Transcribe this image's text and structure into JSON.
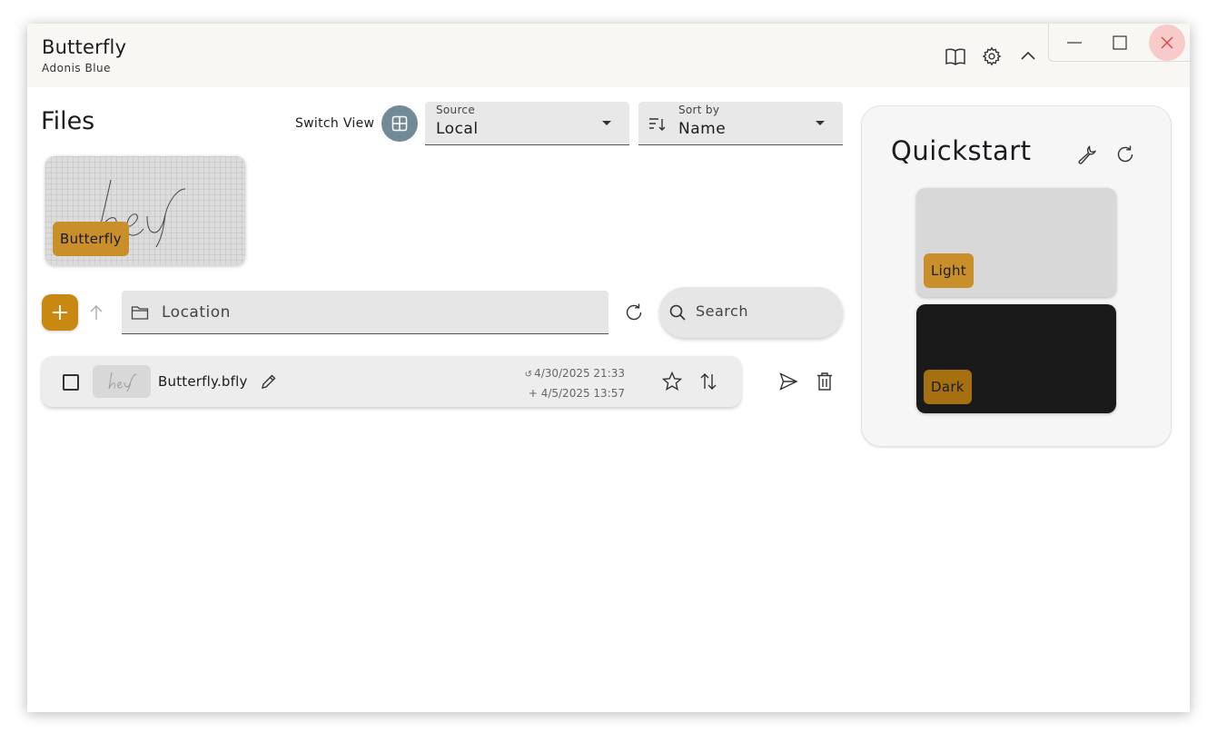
{
  "app": {
    "title": "Butterfly",
    "subtitle": "Adonis Blue"
  },
  "titlebar": {
    "icons": [
      "book-icon",
      "gear-icon",
      "chevron-up-icon"
    ]
  },
  "window_controls": [
    "minimize-icon",
    "maximize-icon",
    "close-icon"
  ],
  "files": {
    "heading": "Files",
    "switch_view_label": "Switch View",
    "source": {
      "label": "Source",
      "value": "Local"
    },
    "sort": {
      "label": "Sort by",
      "value": "Name"
    },
    "recent_card": {
      "name": "Butterfly",
      "preview_text": "hey"
    }
  },
  "toolbar": {
    "location_placeholder": "Location",
    "search_placeholder": "Search"
  },
  "file_list": [
    {
      "name": "Butterfly.bfly",
      "thumb_text": "hey",
      "modified": "4/30/2025 21:33",
      "created": "+ 4/5/2025 13:57"
    }
  ],
  "quickstart": {
    "title": "Quickstart",
    "templates": [
      {
        "label": "Light",
        "background": "#d8d8d8",
        "chip_color": "#c98f2b"
      },
      {
        "label": "Dark",
        "background": "#1a1a1a",
        "chip_color": "#a66f10"
      }
    ]
  },
  "colors": {
    "accent": "#c98910",
    "switch_view": "#718a96",
    "close_hover": "#f9caca"
  }
}
